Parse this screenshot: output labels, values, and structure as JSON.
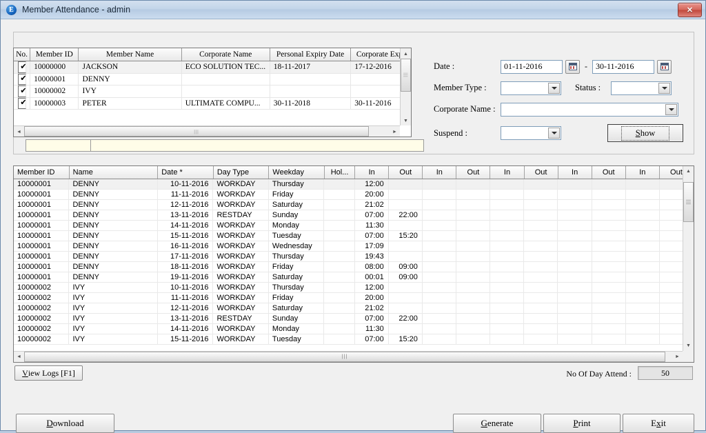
{
  "window": {
    "title": "Member Attendance - admin",
    "app_icon": "E",
    "close_label": "✕"
  },
  "member_grid": {
    "columns": [
      "No.",
      "Member ID",
      "Member Name",
      "Corporate Name",
      "Personal Expiry Date",
      "Corporate Expi"
    ],
    "rows": [
      {
        "checked": true,
        "member_id": "10000000",
        "member_name": "JACKSON",
        "corporate_name": "ECO SOLUTION TEC...",
        "personal_expiry": "18-11-2017",
        "corporate_expiry": "17-12-2016"
      },
      {
        "checked": true,
        "member_id": "10000001",
        "member_name": "DENNY",
        "corporate_name": "",
        "personal_expiry": "",
        "corporate_expiry": ""
      },
      {
        "checked": true,
        "member_id": "10000002",
        "member_name": "IVY",
        "corporate_name": "",
        "personal_expiry": "",
        "corporate_expiry": ""
      },
      {
        "checked": true,
        "member_id": "10000003",
        "member_name": "PETER",
        "corporate_name": "ULTIMATE COMPU...",
        "personal_expiry": "30-11-2018",
        "corporate_expiry": "30-11-2016"
      }
    ],
    "checkbox_glyph": "✔"
  },
  "filters": {
    "date_label": "Date :",
    "date_from": "01-11-2016",
    "date_to": "30-11-2016",
    "date_separator": "-",
    "member_type_label": "Member Type :",
    "member_type_value": "",
    "status_label": "Status :",
    "status_value": "",
    "corporate_name_label": "Corporate Name :",
    "corporate_name_value": "",
    "suspend_label": "Suspend :",
    "suspend_value": "",
    "show_button": {
      "prefix": "",
      "mnemonic": "S",
      "suffix": "how"
    }
  },
  "attendance_table": {
    "columns": [
      "Member ID",
      "Name",
      "Date *",
      "Day Type",
      "Weekday",
      "Hol...",
      "In",
      "Out",
      "In",
      "Out",
      "In",
      "Out",
      "In",
      "Out",
      "In",
      "Out"
    ],
    "rows": [
      {
        "member_id": "10000001",
        "name": "DENNY",
        "date": "10-11-2016",
        "day_type": "WORKDAY",
        "weekday": "Thursday",
        "hol": "",
        "in1": "12:00",
        "out1": "",
        "in2": "",
        "out2": "",
        "in3": "",
        "out3": "",
        "in4": "",
        "out4": "",
        "in5": "",
        "out5": "",
        "selected": true
      },
      {
        "member_id": "10000001",
        "name": "DENNY",
        "date": "11-11-2016",
        "day_type": "WORKDAY",
        "weekday": "Friday",
        "hol": "",
        "in1": "20:00",
        "out1": "",
        "in2": "",
        "out2": "",
        "in3": "",
        "out3": "",
        "in4": "",
        "out4": "",
        "in5": "",
        "out5": "",
        "selected": false
      },
      {
        "member_id": "10000001",
        "name": "DENNY",
        "date": "12-11-2016",
        "day_type": "WORKDAY",
        "weekday": "Saturday",
        "hol": "",
        "in1": "21:02",
        "out1": "",
        "in2": "",
        "out2": "",
        "in3": "",
        "out3": "",
        "in4": "",
        "out4": "",
        "in5": "",
        "out5": "",
        "selected": false
      },
      {
        "member_id": "10000001",
        "name": "DENNY",
        "date": "13-11-2016",
        "day_type": "RESTDAY",
        "weekday": "Sunday",
        "hol": "",
        "in1": "07:00",
        "out1": "22:00",
        "in2": "",
        "out2": "",
        "in3": "",
        "out3": "",
        "in4": "",
        "out4": "",
        "in5": "",
        "out5": "",
        "selected": false
      },
      {
        "member_id": "10000001",
        "name": "DENNY",
        "date": "14-11-2016",
        "day_type": "WORKDAY",
        "weekday": "Monday",
        "hol": "",
        "in1": "11:30",
        "out1": "",
        "in2": "",
        "out2": "",
        "in3": "",
        "out3": "",
        "in4": "",
        "out4": "",
        "in5": "",
        "out5": "",
        "selected": false
      },
      {
        "member_id": "10000001",
        "name": "DENNY",
        "date": "15-11-2016",
        "day_type": "WORKDAY",
        "weekday": "Tuesday",
        "hol": "",
        "in1": "07:00",
        "out1": "15:20",
        "in2": "",
        "out2": "",
        "in3": "",
        "out3": "",
        "in4": "",
        "out4": "",
        "in5": "",
        "out5": "",
        "selected": false
      },
      {
        "member_id": "10000001",
        "name": "DENNY",
        "date": "16-11-2016",
        "day_type": "WORKDAY",
        "weekday": "Wednesday",
        "hol": "",
        "in1": "17:09",
        "out1": "",
        "in2": "",
        "out2": "",
        "in3": "",
        "out3": "",
        "in4": "",
        "out4": "",
        "in5": "",
        "out5": "",
        "selected": false
      },
      {
        "member_id": "10000001",
        "name": "DENNY",
        "date": "17-11-2016",
        "day_type": "WORKDAY",
        "weekday": "Thursday",
        "hol": "",
        "in1": "19:43",
        "out1": "",
        "in2": "",
        "out2": "",
        "in3": "",
        "out3": "",
        "in4": "",
        "out4": "",
        "in5": "",
        "out5": "",
        "selected": false
      },
      {
        "member_id": "10000001",
        "name": "DENNY",
        "date": "18-11-2016",
        "day_type": "WORKDAY",
        "weekday": "Friday",
        "hol": "",
        "in1": "08:00",
        "out1": "09:00",
        "in2": "",
        "out2": "",
        "in3": "",
        "out3": "",
        "in4": "",
        "out4": "",
        "in5": "",
        "out5": "",
        "selected": false
      },
      {
        "member_id": "10000001",
        "name": "DENNY",
        "date": "19-11-2016",
        "day_type": "WORKDAY",
        "weekday": "Saturday",
        "hol": "",
        "in1": "00:01",
        "out1": "09:00",
        "in2": "",
        "out2": "",
        "in3": "",
        "out3": "",
        "in4": "",
        "out4": "",
        "in5": "",
        "out5": "",
        "selected": false
      },
      {
        "member_id": "10000002",
        "name": "IVY",
        "date": "10-11-2016",
        "day_type": "WORKDAY",
        "weekday": "Thursday",
        "hol": "",
        "in1": "12:00",
        "out1": "",
        "in2": "",
        "out2": "",
        "in3": "",
        "out3": "",
        "in4": "",
        "out4": "",
        "in5": "",
        "out5": "",
        "selected": false
      },
      {
        "member_id": "10000002",
        "name": "IVY",
        "date": "11-11-2016",
        "day_type": "WORKDAY",
        "weekday": "Friday",
        "hol": "",
        "in1": "20:00",
        "out1": "",
        "in2": "",
        "out2": "",
        "in3": "",
        "out3": "",
        "in4": "",
        "out4": "",
        "in5": "",
        "out5": "",
        "selected": false
      },
      {
        "member_id": "10000002",
        "name": "IVY",
        "date": "12-11-2016",
        "day_type": "WORKDAY",
        "weekday": "Saturday",
        "hol": "",
        "in1": "21:02",
        "out1": "",
        "in2": "",
        "out2": "",
        "in3": "",
        "out3": "",
        "in4": "",
        "out4": "",
        "in5": "",
        "out5": "",
        "selected": false
      },
      {
        "member_id": "10000002",
        "name": "IVY",
        "date": "13-11-2016",
        "day_type": "RESTDAY",
        "weekday": "Sunday",
        "hol": "",
        "in1": "07:00",
        "out1": "22:00",
        "in2": "",
        "out2": "",
        "in3": "",
        "out3": "",
        "in4": "",
        "out4": "",
        "in5": "",
        "out5": "",
        "selected": false
      },
      {
        "member_id": "10000002",
        "name": "IVY",
        "date": "14-11-2016",
        "day_type": "WORKDAY",
        "weekday": "Monday",
        "hol": "",
        "in1": "11:30",
        "out1": "",
        "in2": "",
        "out2": "",
        "in3": "",
        "out3": "",
        "in4": "",
        "out4": "",
        "in5": "",
        "out5": "",
        "selected": false
      },
      {
        "member_id": "10000002",
        "name": "IVY",
        "date": "15-11-2016",
        "day_type": "WORKDAY",
        "weekday": "Tuesday",
        "hol": "",
        "in1": "07:00",
        "out1": "15:20",
        "in2": "",
        "out2": "",
        "in3": "",
        "out3": "",
        "in4": "",
        "out4": "",
        "in5": "",
        "out5": "",
        "selected": false
      }
    ]
  },
  "status_bar": {
    "view_logs": {
      "mnemonic": "V",
      "suffix": "iew Logs [F1]"
    },
    "attend_label": "No Of Day Attend :",
    "attend_value": "50"
  },
  "footer": {
    "download": {
      "mnemonic": "D",
      "suffix": "ownload"
    },
    "generate": {
      "mnemonic": "G",
      "suffix": "enerate"
    },
    "print": {
      "mnemonic": "P",
      "suffix": "rint"
    },
    "exit": {
      "prefix": "E",
      "mnemonic": "x",
      "suffix": "it"
    }
  },
  "scroll": {
    "left_arrow": "◄",
    "right_arrow": "►",
    "up_arrow": "▲",
    "down_arrow": "▼",
    "grip": "|||"
  }
}
